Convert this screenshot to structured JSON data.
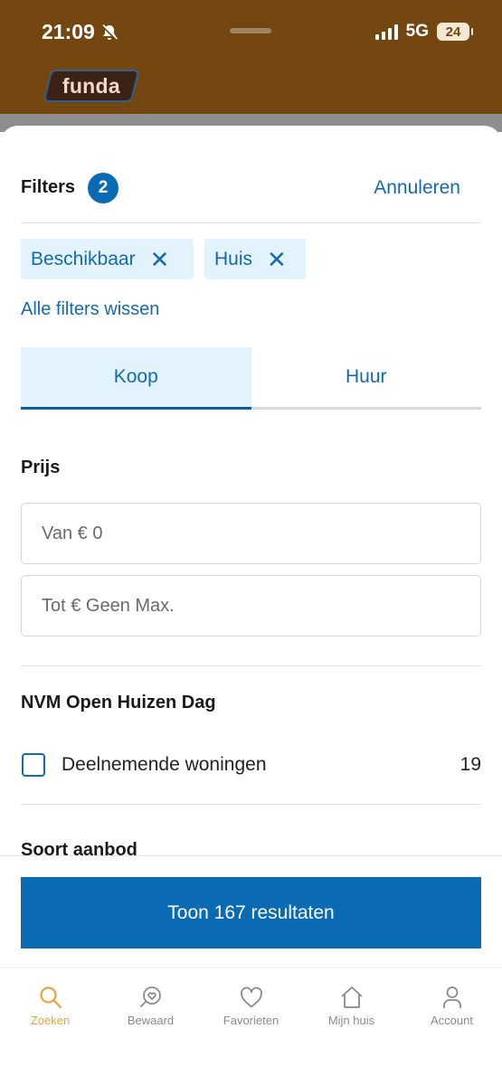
{
  "status_bar": {
    "time": "21:09",
    "network": "5G",
    "battery": "24"
  },
  "app": {
    "logo_text": "funda"
  },
  "filters": {
    "title": "Filters",
    "count": "2",
    "cancel_label": "Annuleren",
    "chips": [
      {
        "label": "Beschikbaar",
        "remove_icon": "close-icon"
      },
      {
        "label": "Huis",
        "remove_icon": "close-icon"
      }
    ],
    "clear_all_label": "Alle filters wissen",
    "tabs": [
      {
        "label": "Koop",
        "active": true
      },
      {
        "label": "Huur",
        "active": false
      }
    ],
    "price": {
      "title": "Prijs",
      "from_value": "Van € 0",
      "to_value": "Tot € Geen Max."
    },
    "open_house": {
      "title": "NVM Open Huizen Dag",
      "option_label": "Deelnemende woningen",
      "option_count": "19",
      "checked": false
    },
    "next_section_title": "Soort aanbod",
    "submit_label": "Toon 167 resultaten"
  },
  "tabbar": {
    "items": [
      {
        "label": "Zoeken",
        "icon": "search-icon",
        "active": true
      },
      {
        "label": "Bewaard",
        "icon": "saved-search-icon",
        "active": false
      },
      {
        "label": "Favorieten",
        "icon": "heart-icon",
        "active": false
      },
      {
        "label": "Mijn huis",
        "icon": "home-icon",
        "active": false
      },
      {
        "label": "Account",
        "icon": "person-icon",
        "active": false
      }
    ]
  },
  "colors": {
    "brand_header": "#744711",
    "accent_blue": "#0a6bb4",
    "chip_background": "#e2f3fd",
    "active_nav": "#e8a23a"
  }
}
